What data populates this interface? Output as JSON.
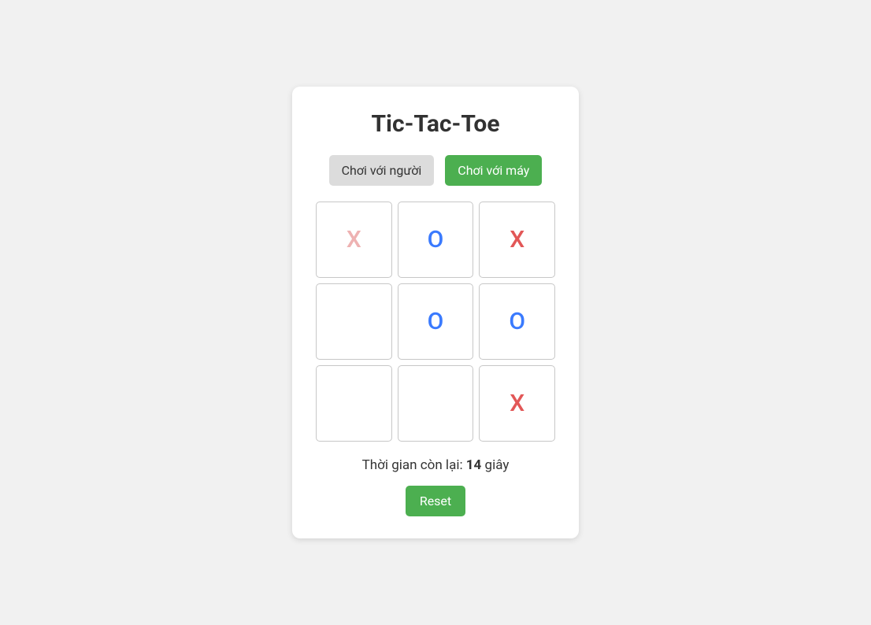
{
  "title": "Tic-Tac-Toe",
  "modes": {
    "human": {
      "label": "Chơi với người",
      "active": false
    },
    "cpu": {
      "label": "Chơi với máy",
      "active": true
    }
  },
  "board": [
    {
      "mark": "X",
      "faded": true
    },
    {
      "mark": "O",
      "faded": false
    },
    {
      "mark": "X",
      "faded": false
    },
    {
      "mark": "",
      "faded": false
    },
    {
      "mark": "O",
      "faded": false
    },
    {
      "mark": "O",
      "faded": false
    },
    {
      "mark": "",
      "faded": false
    },
    {
      "mark": "",
      "faded": false
    },
    {
      "mark": "X",
      "faded": false
    }
  ],
  "timer": {
    "prefix": "Thời gian còn lại: ",
    "value": "14",
    "suffix": " giây"
  },
  "reset_label": "Reset"
}
